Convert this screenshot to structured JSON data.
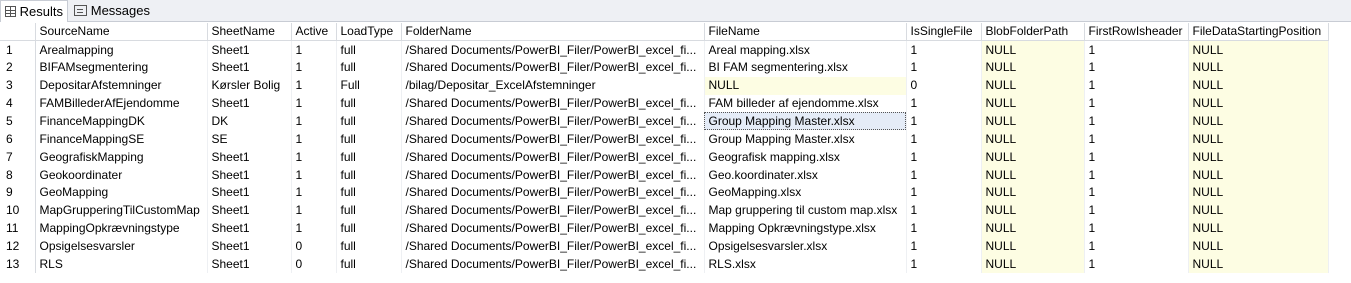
{
  "tabs": [
    {
      "label": "Results",
      "icon": "results-grid-icon"
    },
    {
      "label": "Messages",
      "icon": "messages-icon"
    }
  ],
  "grid": {
    "columns": [
      "SourceName",
      "SheetName",
      "Active",
      "LoadType",
      "FolderName",
      "FileName",
      "IsSingleFile",
      "BlobFolderPath",
      "FirstRowIsheader",
      "FileDataStartingPosition"
    ],
    "rows": [
      {
        "n": "1",
        "c": [
          "Arealmapping",
          "Sheet1",
          "1",
          "full",
          "/Shared Documents/PowerBI_Filer/PowerBI_excel_fi...",
          "Areal mapping.xlsx",
          "1",
          "NULL",
          "1",
          "NULL"
        ]
      },
      {
        "n": "2",
        "c": [
          "BIFAMsegmentering",
          "Sheet1",
          "1",
          "full",
          "/Shared Documents/PowerBI_Filer/PowerBI_excel_fi...",
          "BI FAM segmentering.xlsx",
          "1",
          "NULL",
          "1",
          "NULL"
        ]
      },
      {
        "n": "3",
        "c": [
          "DepositarAfstemninger",
          "Kørsler Bolig",
          "1",
          "Full",
          "/bilag/Depositar_ExcelAfstemninger",
          "NULL",
          "0",
          "NULL",
          "1",
          "NULL"
        ]
      },
      {
        "n": "4",
        "c": [
          "FAMBillederAfEjendomme",
          "Sheet1",
          "1",
          "full",
          "/Shared Documents/PowerBI_Filer/PowerBI_excel_fi...",
          "FAM billeder af ejendomme.xlsx",
          "1",
          "NULL",
          "1",
          "NULL"
        ]
      },
      {
        "n": "5",
        "c": [
          "FinanceMappingDK",
          "DK",
          "1",
          "full",
          "/Shared Documents/PowerBI_Filer/PowerBI_excel_fi...",
          "Group Mapping Master.xlsx",
          "1",
          "NULL",
          "1",
          "NULL"
        ]
      },
      {
        "n": "6",
        "c": [
          "FinanceMappingSE",
          "SE",
          "1",
          "full",
          "/Shared Documents/PowerBI_Filer/PowerBI_excel_fi...",
          "Group Mapping Master.xlsx",
          "1",
          "NULL",
          "1",
          "NULL"
        ]
      },
      {
        "n": "7",
        "c": [
          "GeografiskMapping",
          "Sheet1",
          "1",
          "full",
          "/Shared Documents/PowerBI_Filer/PowerBI_excel_fi...",
          "Geografisk mapping.xlsx",
          "1",
          "NULL",
          "1",
          "NULL"
        ]
      },
      {
        "n": "8",
        "c": [
          "Geokoordinater",
          "Sheet1",
          "1",
          "full",
          "/Shared Documents/PowerBI_Filer/PowerBI_excel_fi...",
          "Geo.koordinater.xlsx",
          "1",
          "NULL",
          "1",
          "NULL"
        ]
      },
      {
        "n": "9",
        "c": [
          "GeoMapping",
          "Sheet1",
          "1",
          "full",
          "/Shared Documents/PowerBI_Filer/PowerBI_excel_fi...",
          "GeoMapping.xlsx",
          "1",
          "NULL",
          "1",
          "NULL"
        ]
      },
      {
        "n": "10",
        "c": [
          "MapGrupperingTilCustomMap",
          "Sheet1",
          "1",
          "full",
          "/Shared Documents/PowerBI_Filer/PowerBI_excel_fi...",
          "Map gruppering til custom map.xlsx",
          "1",
          "NULL",
          "1",
          "NULL"
        ]
      },
      {
        "n": "11",
        "c": [
          "MappingOpkrævningstype",
          "Sheet1",
          "1",
          "full",
          "/Shared Documents/PowerBI_Filer/PowerBI_excel_fi...",
          "Mapping Opkrævningstype.xlsx",
          "1",
          "NULL",
          "1",
          "NULL"
        ]
      },
      {
        "n": "12",
        "c": [
          "Opsigelsesvarsler",
          "Sheet1",
          "0",
          "full",
          "/Shared Documents/PowerBI_Filer/PowerBI_excel_fi...",
          "Opsigelsesvarsler.xlsx",
          "1",
          "NULL",
          "1",
          "NULL"
        ]
      },
      {
        "n": "13",
        "c": [
          "RLS",
          "Sheet1",
          "0",
          "full",
          "/Shared Documents/PowerBI_Filer/PowerBI_excel_fi...",
          "RLS.xlsx",
          "1",
          "NULL",
          "1",
          "NULL"
        ]
      }
    ],
    "selected_cell": {
      "row": 4,
      "col": 5
    },
    "colors": {
      "null_highlight": "#fdfde3",
      "selection": "#e5ecf7"
    }
  }
}
